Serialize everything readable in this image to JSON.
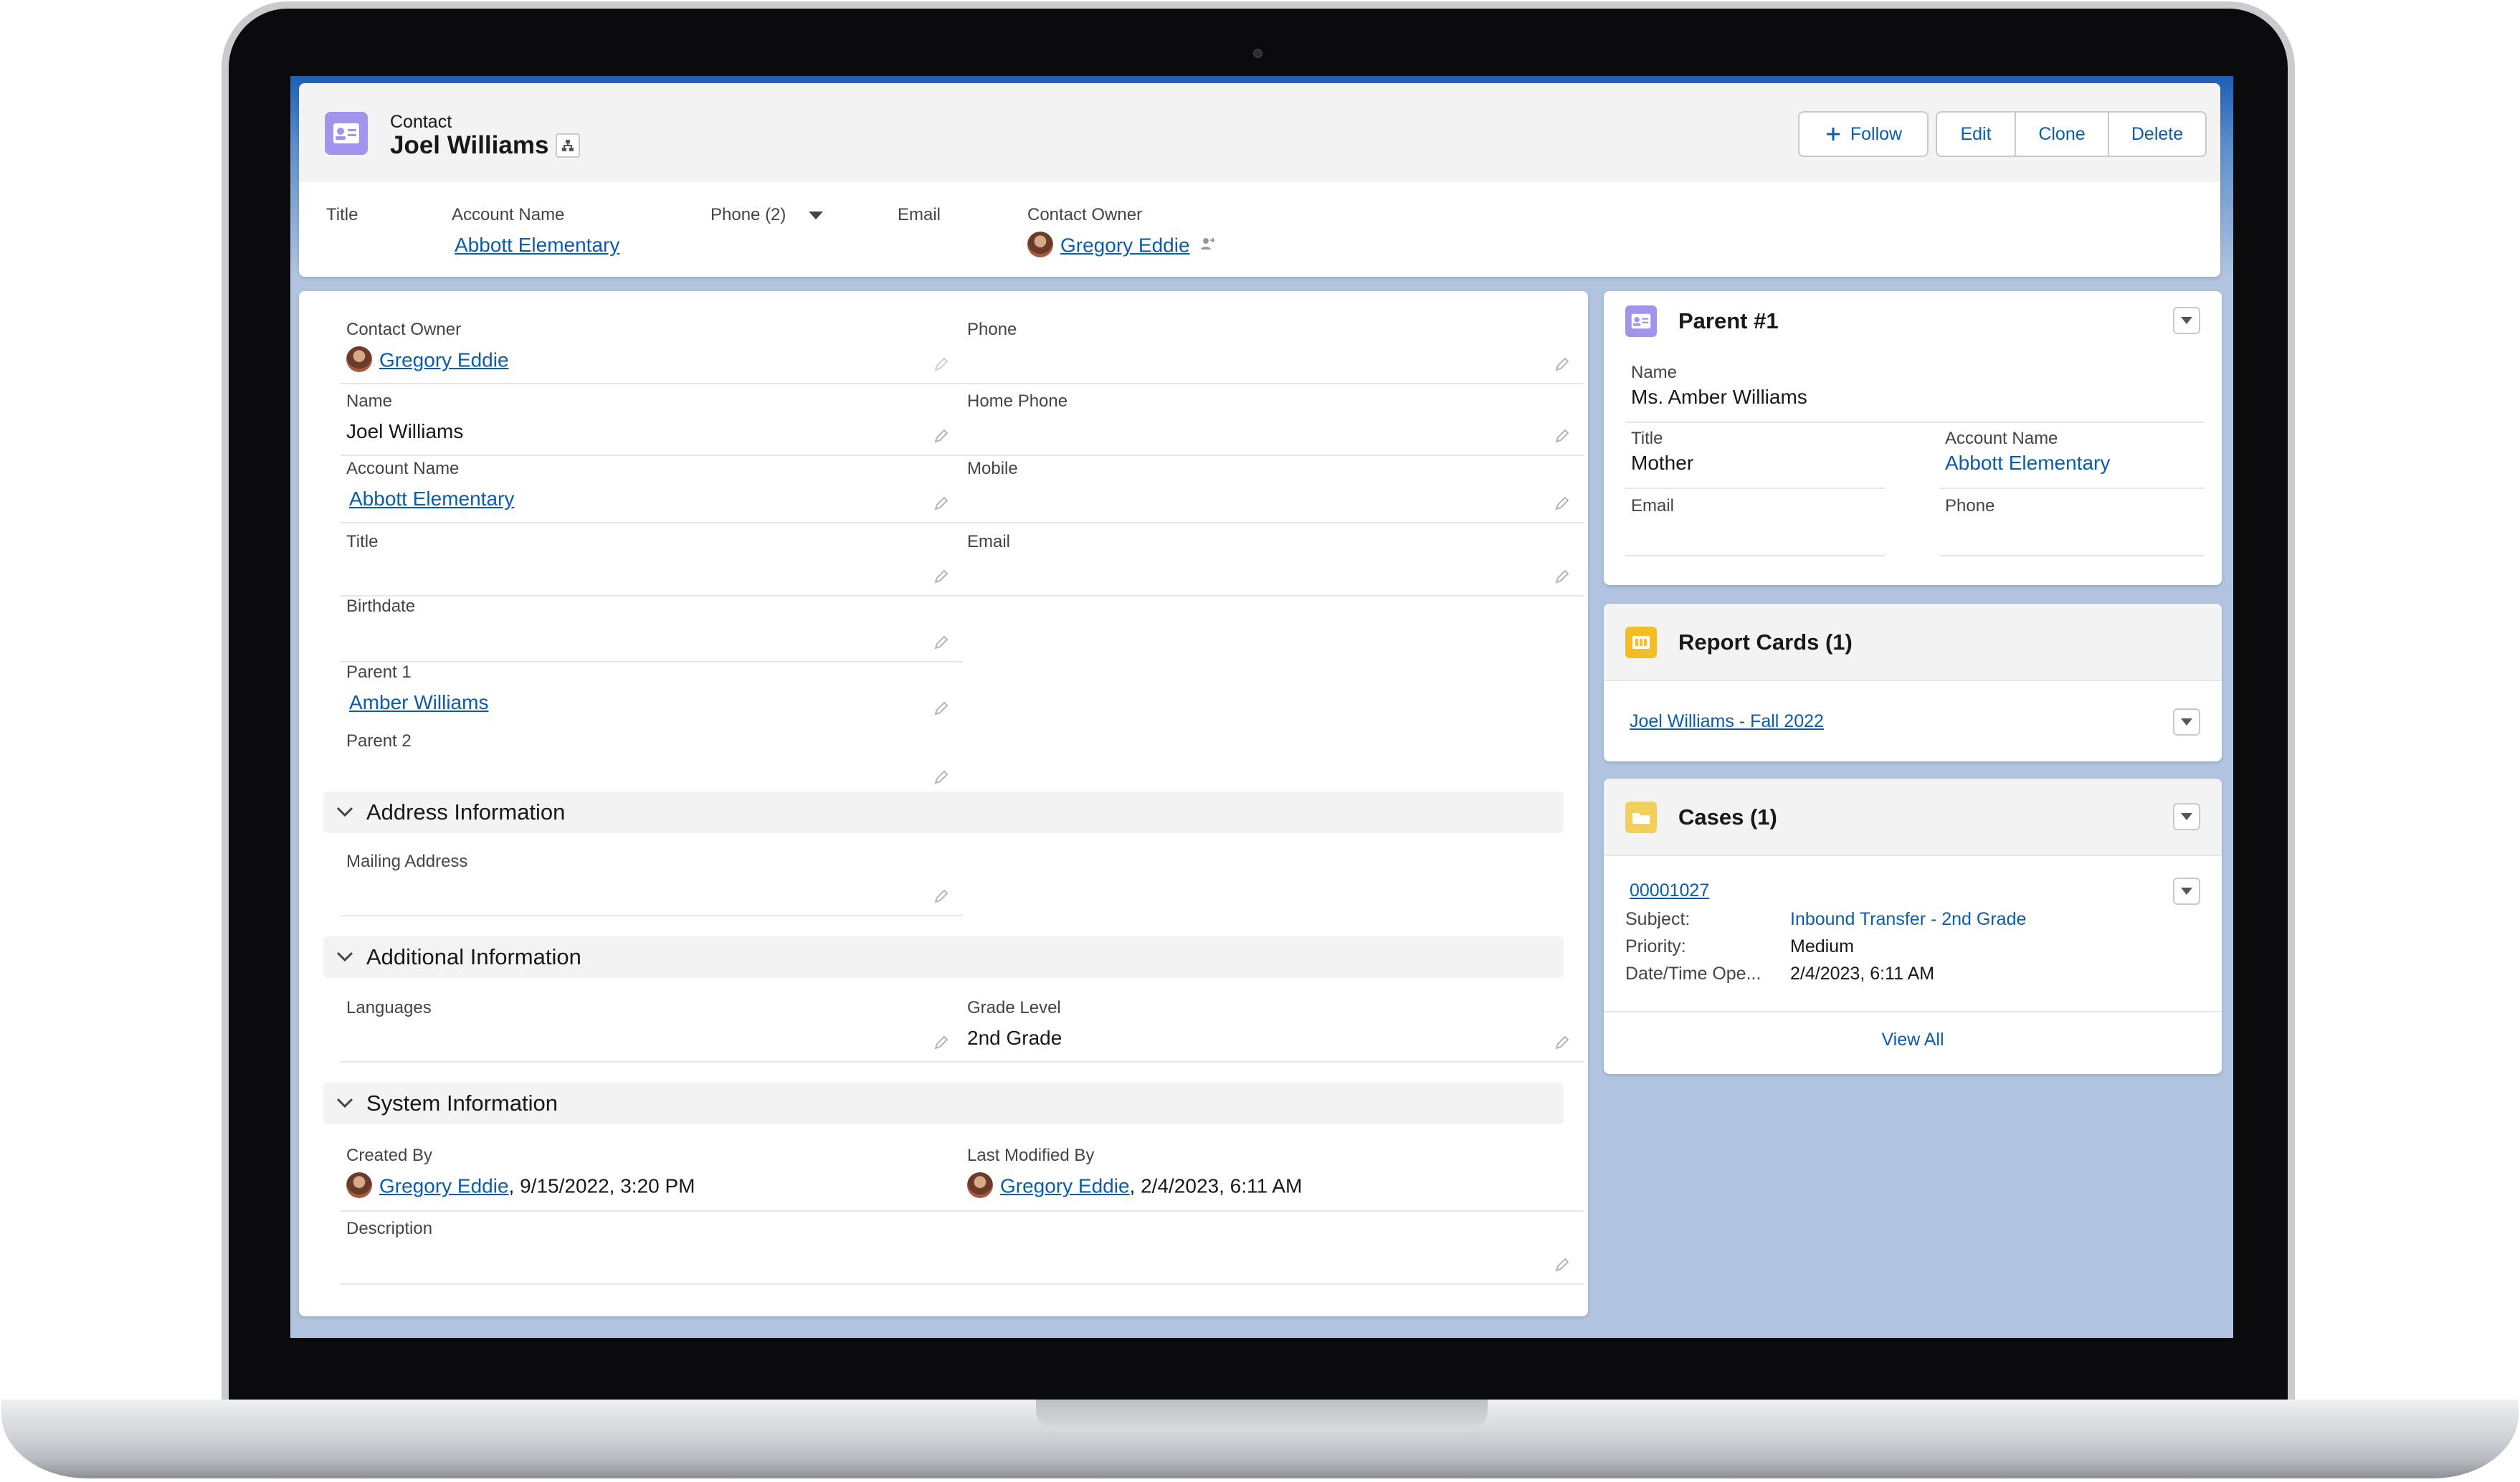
{
  "header": {
    "object_type": "Contact",
    "record_name": "Joel Williams",
    "buttons": {
      "follow": "Follow",
      "edit": "Edit",
      "clone": "Clone",
      "delete": "Delete"
    }
  },
  "highlights": {
    "title_label": "Title",
    "account_label": "Account Name",
    "account_value": "Abbott Elementary",
    "phone_label": "Phone (2)",
    "email_label": "Email",
    "owner_label": "Contact Owner",
    "owner_value": "Gregory Eddie"
  },
  "details": {
    "contact_owner_label": "Contact Owner",
    "contact_owner_value": "Gregory Eddie",
    "name_label": "Name",
    "name_value": "Joel Williams",
    "account_label": "Account Name",
    "account_value": "Abbott Elementary",
    "title_label": "Title",
    "birthdate_label": "Birthdate",
    "parent1_label": "Parent 1",
    "parent1_value": "Amber Williams",
    "parent2_label": "Parent 2",
    "phone_label": "Phone",
    "home_phone_label": "Home Phone",
    "mobile_label": "Mobile",
    "email_label": "Email"
  },
  "sections": {
    "address": "Address Information",
    "mailing_address_label": "Mailing Address",
    "additional": "Additional Information",
    "languages_label": "Languages",
    "grade_level_label": "Grade Level",
    "grade_level_value": "2nd Grade",
    "system": "System Information",
    "created_by_label": "Created By",
    "created_by_user": "Gregory Eddie",
    "created_by_date": ", 9/15/2022, 3:20 PM",
    "modified_by_label": "Last Modified By",
    "modified_by_user": "Gregory Eddie",
    "modified_by_date": ", 2/4/2023, 6:11 AM",
    "description_label": "Description"
  },
  "parent_card": {
    "title": "Parent #1",
    "name_label": "Name",
    "name_value": "Ms. Amber Williams",
    "title_label": "Title",
    "title_value": "Mother",
    "account_label": "Account Name",
    "account_value": "Abbott Elementary",
    "email_label": "Email",
    "phone_label": "Phone"
  },
  "report_cards": {
    "title": "Report Cards (1)",
    "item": "Joel Williams - Fall 2022"
  },
  "cases": {
    "title": "Cases (1)",
    "case_number": "00001027",
    "subject_label": "Subject:",
    "subject_value": "Inbound Transfer - 2nd Grade",
    "priority_label": "Priority:",
    "priority_value": "Medium",
    "opened_label": "Date/Time Ope...",
    "opened_value": "2/4/2023, 6:11 AM",
    "view_all": "View All"
  },
  "colors": {
    "link": "#0b5cab",
    "contact_icon": "#a094ed",
    "report_icon": "#f4bc25",
    "case_icon": "#f2cf5b",
    "background": "#b0c4df"
  },
  "icons": {
    "contact": "contact-card-icon",
    "hierarchy": "hierarchy-icon",
    "pencil": "pencil-icon",
    "chevron": "chevron-down-icon",
    "report": "report-card-icon",
    "case": "case-folder-icon"
  }
}
